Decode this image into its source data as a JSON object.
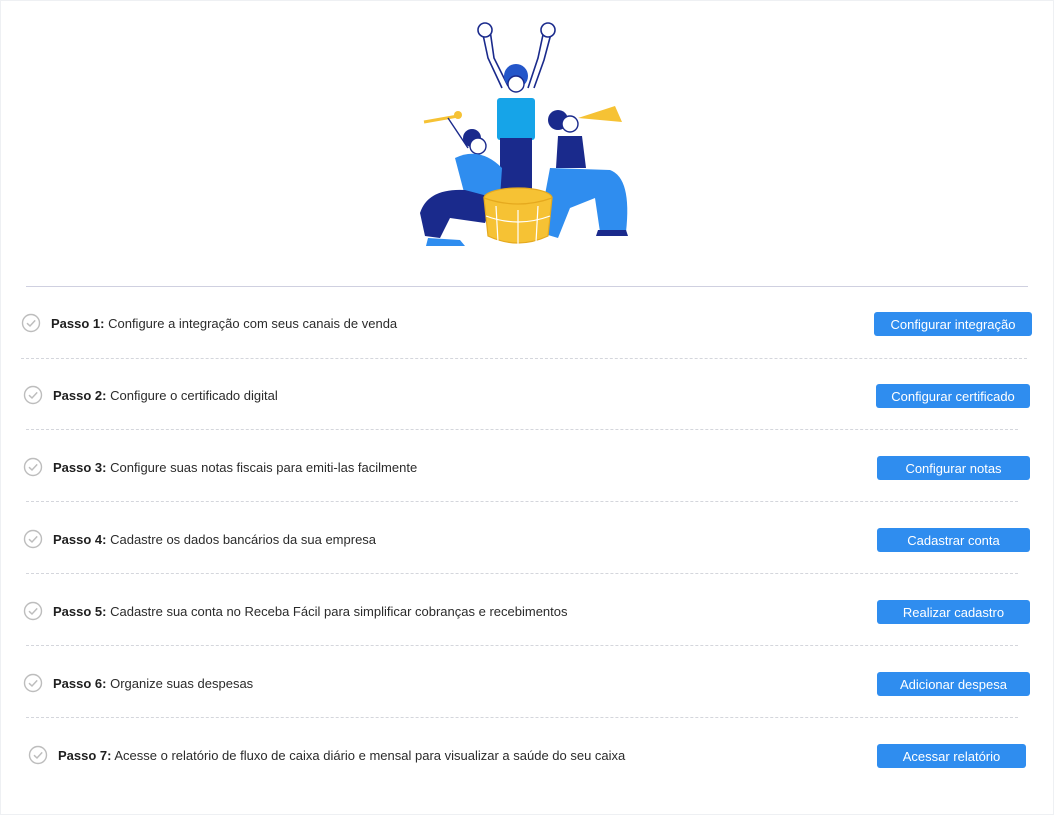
{
  "illustration": {
    "icon": "celebration-illustration"
  },
  "steps": [
    {
      "label": "Passo 1:",
      "text": " Configure a integração com seus canais de venda",
      "button": "Configurar integração"
    },
    {
      "label": "Passo 2:",
      "text": " Configure o certificado digital",
      "button": "Configurar certificado"
    },
    {
      "label": "Passo 3:",
      "text": " Configure suas notas fiscais para emiti-las facilmente",
      "button": "Configurar notas"
    },
    {
      "label": "Passo 4:",
      "text": " Cadastre os dados bancários da sua empresa",
      "button": "Cadastrar conta"
    },
    {
      "label": "Passo 5:",
      "text": " Cadastre sua conta no Receba Fácil para simplificar cobranças e recebimentos",
      "button": "Realizar cadastro"
    },
    {
      "label": "Passo 6:",
      "text": " Organize suas despesas",
      "button": "Adicionar despesa"
    },
    {
      "label": "Passo 7:",
      "text": " Acesse o relatório de fluxo de caixa diário e mensal para visualizar a saúde do seu caixa",
      "button": "Acessar relatório"
    }
  ],
  "colors": {
    "accent": "#2f8def",
    "check": "#bdbdbd",
    "divider": "#d4d6dc"
  }
}
